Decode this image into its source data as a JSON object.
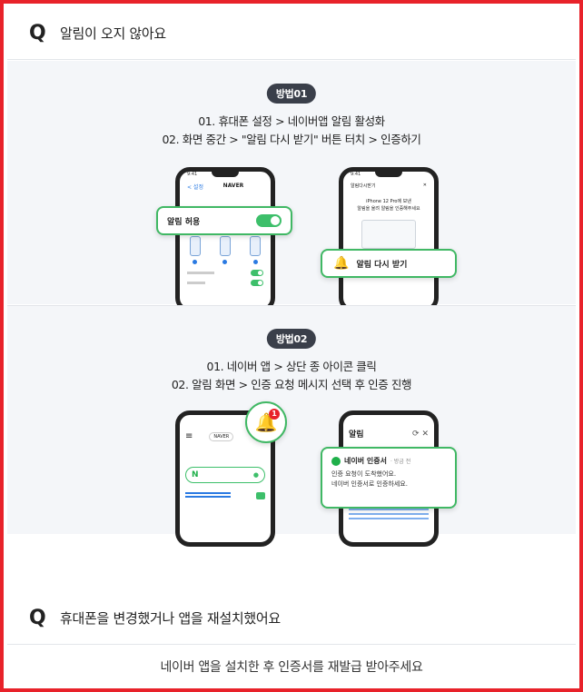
{
  "faq": [
    {
      "q_mark": "Q",
      "question": "알림이 오지 않아요"
    },
    {
      "q_mark": "Q",
      "question": "휴대폰을 변경했거나 앱을 재설치했어요"
    }
  ],
  "method1": {
    "badge": "방법01",
    "line1": "01. 휴대폰 설정 > 네이버앱 알림 활성화",
    "line2": "02. 화면 중간 > \"알림 다시 받기\" 버튼 터치 > 인증하기",
    "phone1": {
      "status": "9:41",
      "back": "< 설정",
      "title": "NAVER",
      "toggle_label": "알림 허용"
    },
    "phone2": {
      "status": "9:41",
      "label": "알림다시받기",
      "title": "iPhone 12 Pro에 보낸",
      "subtitle": "알림을 울려 알림을 인증해주세요",
      "button_label": "알림 다시 받기"
    }
  },
  "method2": {
    "badge": "방법02",
    "line1": "01. 네이버 앱 > 상단 종 아이콘 클릭",
    "line2": "02. 알림 화면 > 인증 요청 메시지 선택 후 인증 진행",
    "bell_count": "1",
    "phone3": {
      "menu": "≡",
      "chip": "NAVER",
      "logo": "N"
    },
    "phone4": {
      "title": "알림",
      "card_title": "네이버 인증서",
      "card_time": "· 방금 전",
      "card_line1": "인증 요청이 도착했어요.",
      "card_line2": "네이버 인증서로 인증하세요."
    }
  },
  "answer2": "네이버 앱을 설치한 후 인증서를 재발급 받아주세요",
  "colors": {
    "frame": "#e8222a",
    "accent_green": "#40b864",
    "panel_bg": "#f4f6f9",
    "badge_bg": "#3a3f4a",
    "notif_red": "#e8222a"
  }
}
